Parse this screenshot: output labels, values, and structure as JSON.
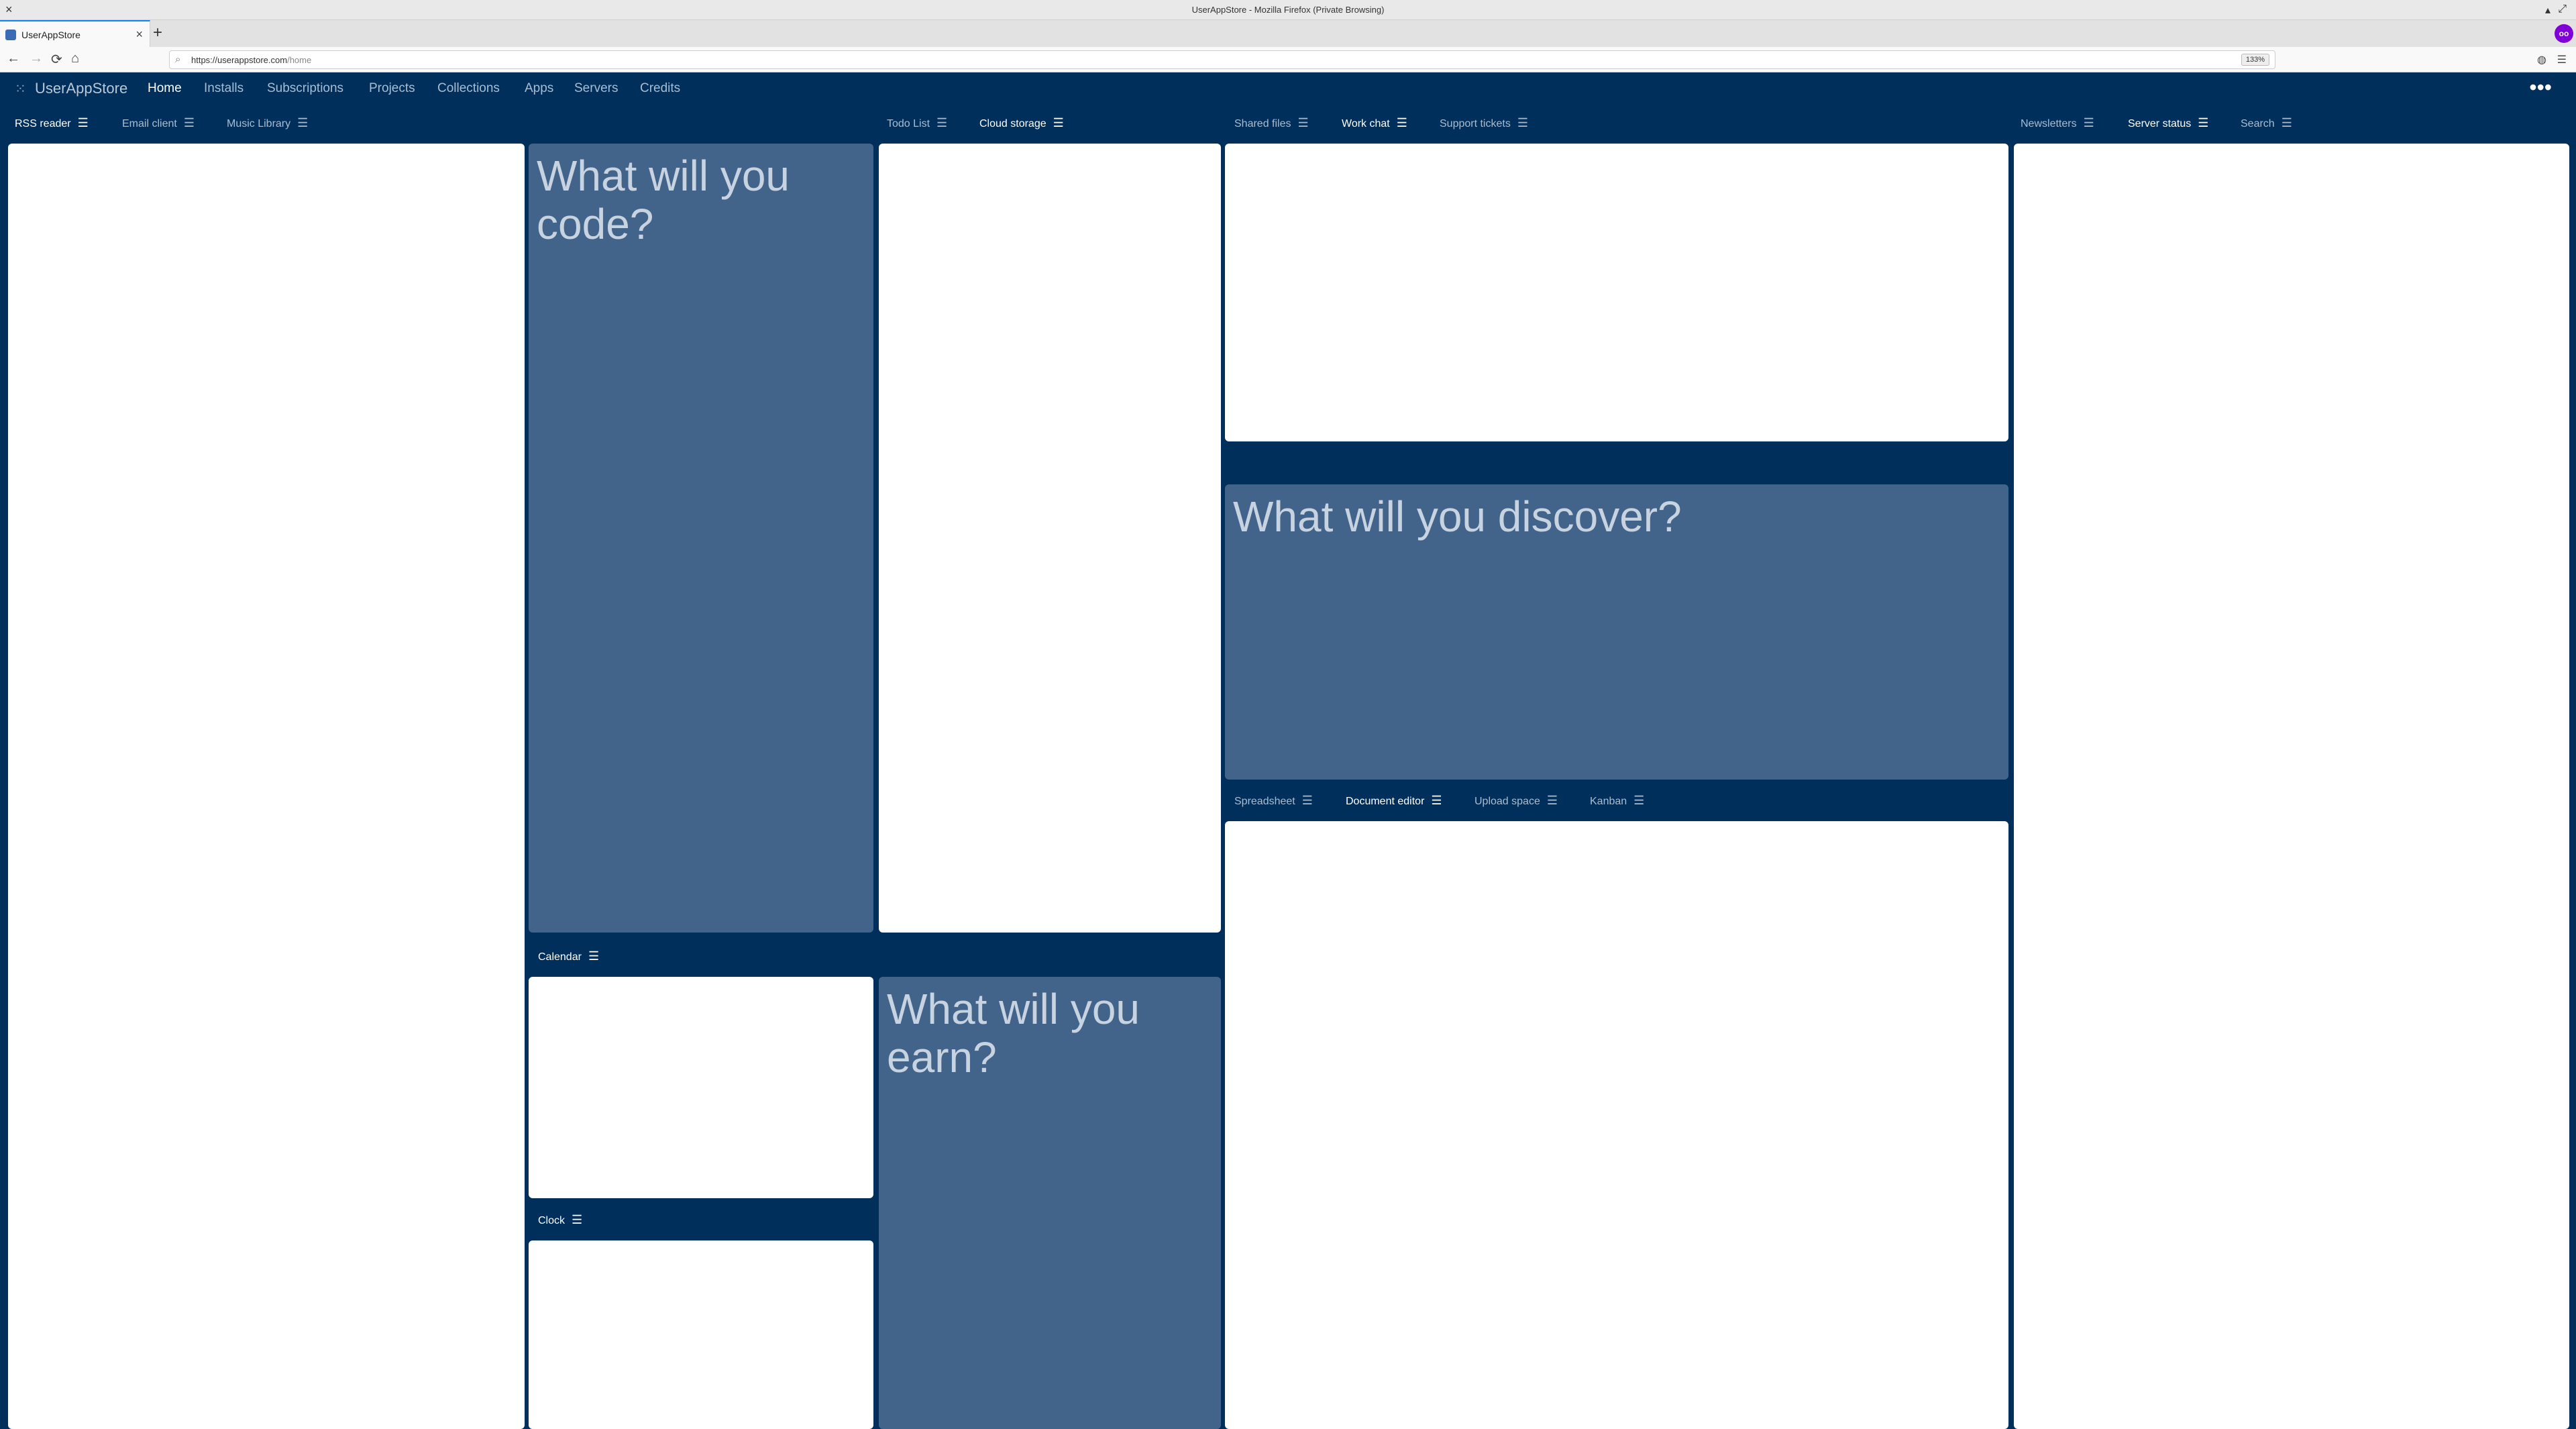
{
  "browser": {
    "window_title": "UserAppStore - Mozilla Firefox (Private Browsing)",
    "tab_title": "UserAppStore",
    "url_host": "https://userappstore.com",
    "url_path": "/home",
    "zoom": "133%"
  },
  "app": {
    "brand": "UserAppStore",
    "nav": [
      "Home",
      "Installs",
      "Subscriptions",
      "Projects",
      "Collections",
      "Apps",
      "Servers",
      "Credits"
    ]
  },
  "groups": {
    "left": [
      "RSS reader",
      "Email client",
      "Music Library"
    ],
    "center": [
      "Todo List",
      "Cloud storage"
    ],
    "work": [
      "Shared files",
      "Work chat",
      "Support tickets"
    ],
    "right": [
      "Newsletters",
      "Server status",
      "Search"
    ],
    "docs": [
      "Spreadsheet",
      "Document editor",
      "Upload space",
      "Kanban"
    ],
    "calendar": [
      "Calendar"
    ],
    "clock": [
      "Clock"
    ]
  },
  "promos": {
    "code": "What will you code?",
    "discover": "What will you discover?",
    "earn": "What will you earn?"
  },
  "icons": {
    "menu": "☰",
    "back": "←",
    "forward": "→",
    "reload": "⟳",
    "home": "⌂",
    "grid": "⁙",
    "more": "•••",
    "close": "×",
    "new_tab": "+"
  }
}
